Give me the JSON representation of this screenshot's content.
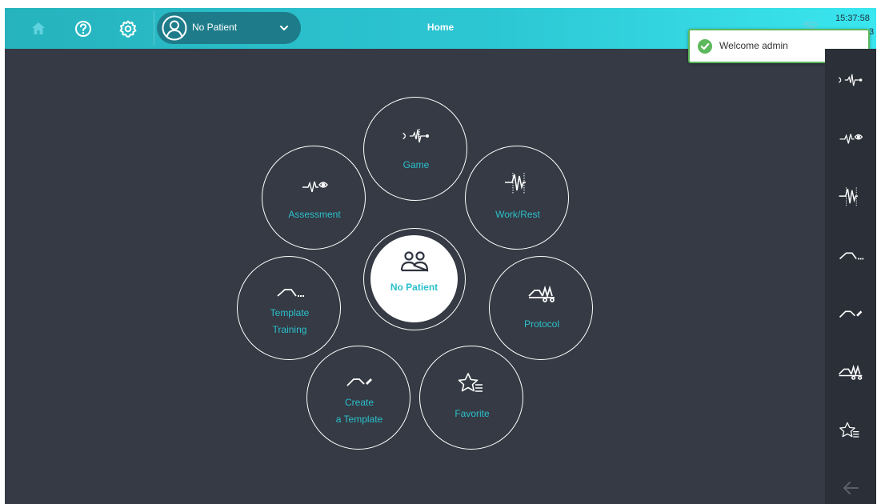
{
  "topbar": {
    "title": "Home",
    "patient": {
      "name": "No Patient"
    },
    "clock": "15:37:58",
    "clock_sub": "3",
    "icons": [
      "home-icon",
      "help-icon",
      "settings-icon",
      "wifi-icon",
      "chevron-down-icon",
      "user-icon"
    ]
  },
  "toast": {
    "text": "Welcome admin",
    "icon": "check-circle-icon",
    "color": "#5cb85c"
  },
  "menu": {
    "center": {
      "label": "No Patient",
      "icon": "patients-icon"
    },
    "game": {
      "label": "Game",
      "icon": "game-signal-icon"
    },
    "assessment": {
      "label": "Assessment",
      "icon": "assessment-eye-icon"
    },
    "workrest": {
      "label": "Work/Rest",
      "icon": "work-rest-icon"
    },
    "template_training": {
      "line1": "Template",
      "line2": "Training",
      "icon": "template-training-icon"
    },
    "protocol": {
      "label": "Protocol",
      "icon": "protocol-icon"
    },
    "create_template": {
      "line1": "Create",
      "line2": "a Template",
      "icon": "create-template-icon"
    },
    "favorite": {
      "label": "Favorite",
      "icon": "favorite-list-icon"
    }
  },
  "rail": {
    "items": [
      "game",
      "assessment",
      "work-rest",
      "template-training",
      "create-template",
      "protocol",
      "favorite",
      "back"
    ]
  },
  "colors": {
    "accent": "#2bc0cc",
    "background": "#353a44",
    "rail": "#2b2f37",
    "topbar_start": "#26b3bd",
    "topbar_end": "#3ae6ef"
  }
}
